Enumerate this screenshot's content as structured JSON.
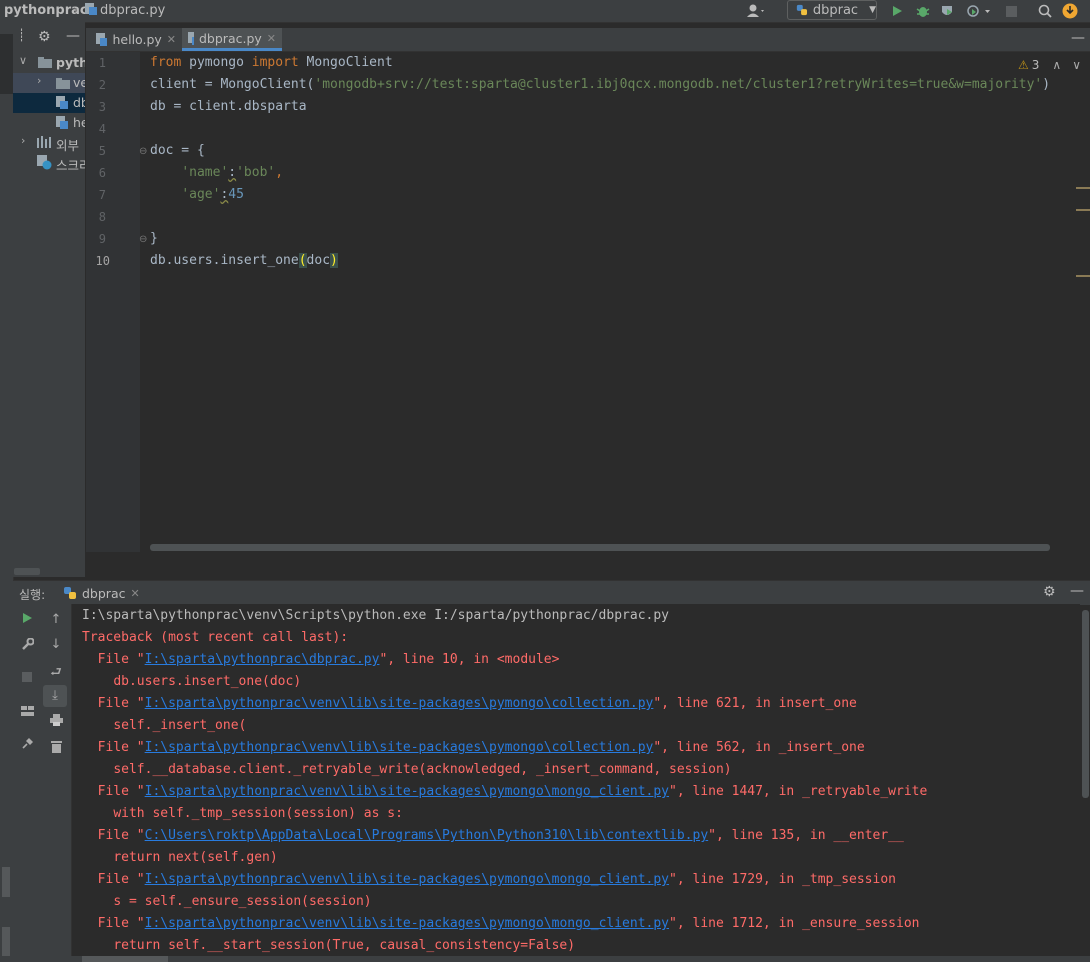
{
  "breadcrumb": {
    "project": "pythonprac",
    "file": "dbprac.py"
  },
  "toolbar": {
    "run_config": "dbprac"
  },
  "project_panel": {
    "items": [
      {
        "label": "pytho",
        "indent": 0
      },
      {
        "label": "ve",
        "indent": 1
      },
      {
        "label": "db",
        "indent": 2
      },
      {
        "label": "he",
        "indent": 2
      },
      {
        "label": "외부",
        "indent": 0
      },
      {
        "label": "스크리",
        "indent": 0
      }
    ]
  },
  "tabs": [
    {
      "label": "hello.py",
      "active": false
    },
    {
      "label": "dbprac.py",
      "active": true
    }
  ],
  "editor": {
    "warnings": "3",
    "line_numbers": [
      "1",
      "2",
      "3",
      "4",
      "5",
      "6",
      "7",
      "8",
      "9",
      "10"
    ],
    "lines": [
      [
        "from",
        " pymongo ",
        "import",
        " MongoClient"
      ],
      [
        "client = MongoClient(",
        "'mongodb+srv://test:sparta@cluster1.ibj0qcx.mongodb.net/cluster1?retryWrites=true&w=majority'",
        ")"
      ],
      [
        "db = client.dbsparta"
      ],
      [
        ""
      ],
      [
        "doc = {"
      ],
      [
        "    ",
        "'name'",
        ":",
        "'bob'",
        ","
      ],
      [
        "    ",
        "'age'",
        ":",
        "45"
      ],
      [
        ""
      ],
      [
        "}"
      ],
      [
        "db.users.insert_one",
        "(",
        "doc",
        ")"
      ]
    ]
  },
  "run_panel": {
    "title": "실행:",
    "tab_label": "dbprac"
  },
  "console": {
    "command": "I:\\sparta\\pythonprac\\venv\\Scripts\\python.exe I:/sparta/pythonprac/dbprac.py",
    "traceback_header": "Traceback (most recent call last):",
    "frames": [
      {
        "path": "I:\\sparta\\pythonprac\\dbprac.py",
        "suffix": "\", line 10, in <module>",
        "code": "db.users.insert_one(doc)"
      },
      {
        "path": "I:\\sparta\\pythonprac\\venv\\lib\\site-packages\\pymongo\\collection.py",
        "suffix": "\", line 621, in insert_one",
        "code": "self._insert_one("
      },
      {
        "path": "I:\\sparta\\pythonprac\\venv\\lib\\site-packages\\pymongo\\collection.py",
        "suffix": "\", line 562, in _insert_one",
        "code": "self.__database.client._retryable_write(acknowledged, _insert_command, session)"
      },
      {
        "path": "I:\\sparta\\pythonprac\\venv\\lib\\site-packages\\pymongo\\mongo_client.py",
        "suffix": "\", line 1447, in _retryable_write",
        "code": "with self._tmp_session(session) as s:"
      },
      {
        "path": "C:\\Users\\roktp\\AppData\\Local\\Programs\\Python\\Python310\\lib\\contextlib.py",
        "suffix": "\", line 135, in __enter__",
        "code": "return next(self.gen)"
      },
      {
        "path": "I:\\sparta\\pythonprac\\venv\\lib\\site-packages\\pymongo\\mongo_client.py",
        "suffix": "\", line 1729, in _tmp_session",
        "code": "s = self._ensure_session(session)"
      },
      {
        "path": "I:\\sparta\\pythonprac\\venv\\lib\\site-packages\\pymongo\\mongo_client.py",
        "suffix": "\", line 1712, in _ensure_session",
        "code": "return self.__start_session(True, causal_consistency=False)"
      }
    ]
  },
  "colors": {
    "accent": "#4a88c7",
    "error": "#ff6b68",
    "link": "#287bde",
    "run_green": "#59a869",
    "update_orange": "#f0a732"
  }
}
